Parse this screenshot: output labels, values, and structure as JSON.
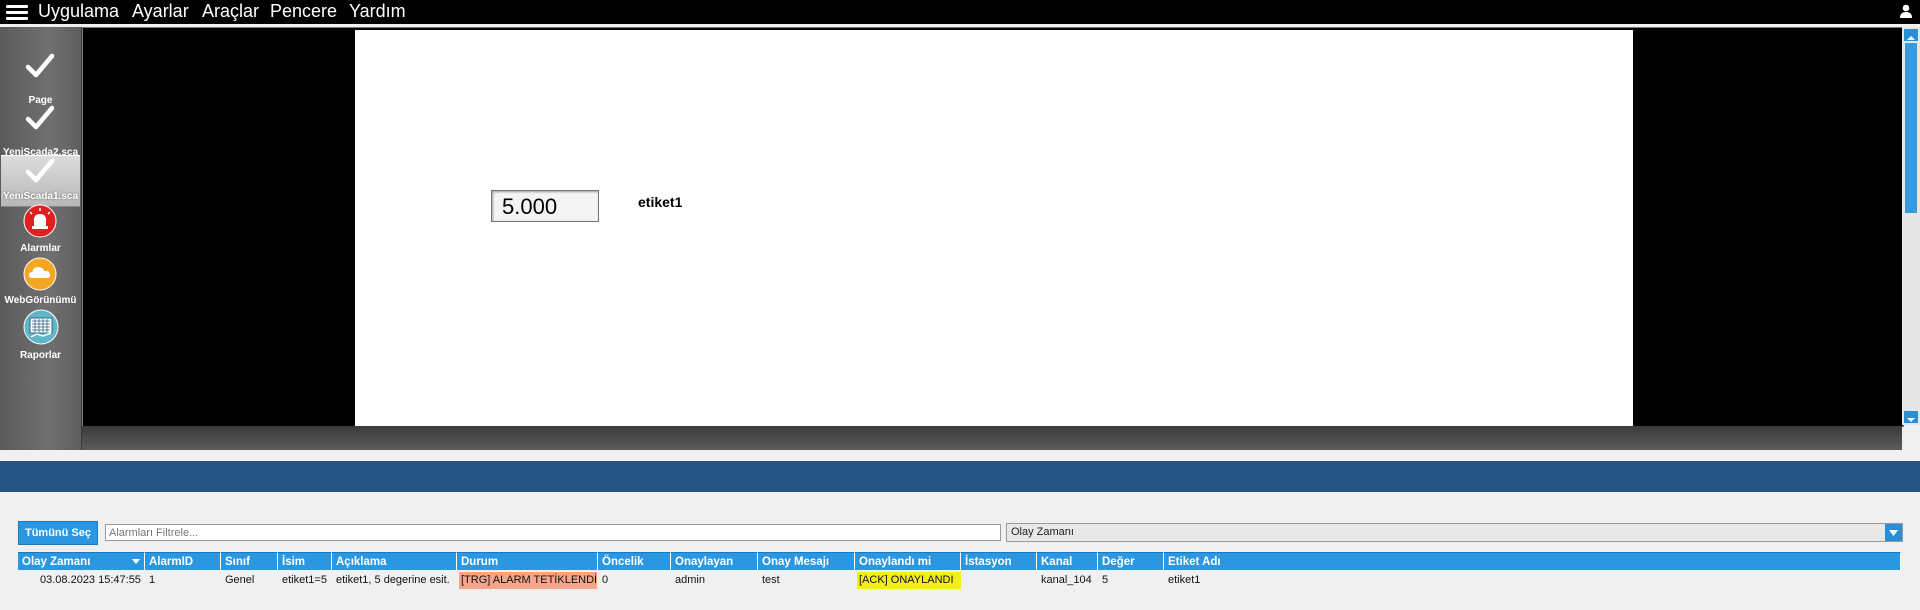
{
  "menu": {
    "items": [
      "Uygulama",
      "Ayarlar",
      "Araçlar",
      "Pencere",
      "Yardım"
    ]
  },
  "sidebar": {
    "items": [
      {
        "label": "Page",
        "icon": "check-icon"
      },
      {
        "label": "YeniScada2.sca",
        "icon": "check-icon"
      },
      {
        "label": "YeniScada1.sca",
        "icon": "check-icon",
        "active": true
      },
      {
        "label": "Alarmlar",
        "icon": "alarm-siren-icon"
      },
      {
        "label": "WebGörünümü",
        "icon": "cloud-icon"
      },
      {
        "label": "Raporlar",
        "icon": "report-chart-icon"
      }
    ]
  },
  "canvas": {
    "value_display": "5.000",
    "tag_label": "etiket1"
  },
  "alarm_panel": {
    "select_all_label": "Tümünü Seç",
    "filter_placeholder": "Alarmları Filtrele...",
    "sort_selected": "Olay Zamanı",
    "columns": [
      "Olay Zamanı",
      "AlarmID",
      "Sınıf",
      "İsim",
      "Açıklama",
      "Durum",
      "Öncelik",
      "Onaylayan",
      "Onay Mesajı",
      "Onaylandı mi",
      "İstasyon",
      "Kanal",
      "Değer",
      "Etiket Adı"
    ],
    "rows": [
      [
        "03.08.2023 15:47:55",
        "1",
        "Genel",
        "etiket1=5",
        "etiket1, 5 degerine esit.",
        "[TRG] ALARM TETİKLENDİ",
        "0",
        "admin",
        "test",
        "[ACK] ONAYLANDI",
        "",
        "kanal_104",
        "5",
        "etiket1"
      ]
    ]
  },
  "colors": {
    "accent": "#2b97e0",
    "band": "#245484",
    "trg_state": "#f7a58a",
    "ack_state": "#f2ee1a"
  }
}
